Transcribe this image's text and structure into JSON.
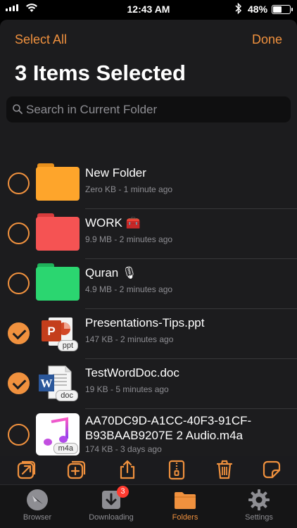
{
  "status_bar": {
    "time": "12:43 AM",
    "battery": "48%",
    "battery_level": 0.48
  },
  "nav": {
    "select_all": "Select All",
    "done": "Done"
  },
  "title": "3 Items Selected",
  "search": {
    "placeholder": "Search in Current Folder"
  },
  "items": [
    {
      "name": "New Folder",
      "meta": "Zero KB - 1 minute ago",
      "selected": false,
      "kind": "folder",
      "color": "#fea52b"
    },
    {
      "name": "WORK 🧰",
      "meta": "9.9 MB - 2 minutes ago",
      "selected": false,
      "kind": "folder",
      "color": "#f55353"
    },
    {
      "name": "Quran 🎙",
      "meta": "4.9 MB - 2 minutes ago",
      "selected": false,
      "kind": "folder",
      "color": "#2bd670"
    },
    {
      "name": "Presentations-Tips.ppt",
      "meta": "147 KB - 2 minutes ago",
      "selected": true,
      "kind": "ppt",
      "badge": "ppt"
    },
    {
      "name": "TestWordDoc.doc",
      "meta": "19 KB - 5 minutes ago",
      "selected": true,
      "kind": "doc",
      "badge": "doc"
    },
    {
      "name": "AA70DC9D-A1CC-40F3-91CF-",
      "name_line2": "B93BAAB9207E 2 Audio.m4a",
      "meta": "174 KB - 3 days ago",
      "selected": false,
      "kind": "audio",
      "badge": "m4a"
    }
  ],
  "tabs": [
    {
      "label": "Browser",
      "icon": "compass-icon"
    },
    {
      "label": "Downloading",
      "icon": "download-icon",
      "badge": "3"
    },
    {
      "label": "Folders",
      "icon": "folder-icon",
      "active": true
    },
    {
      "label": "Settings",
      "icon": "gear-icon"
    }
  ],
  "accent_color": "#f0913e"
}
